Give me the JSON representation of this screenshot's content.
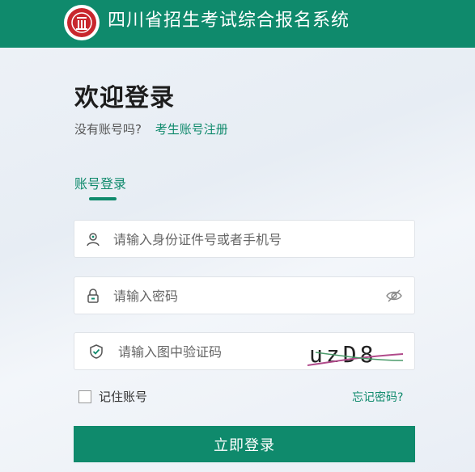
{
  "header": {
    "title": "四川省招生考试综合报名系统",
    "logo_icon": "red-seal-logo"
  },
  "login": {
    "welcome": "欢迎登录",
    "no_account": "没有账号吗?",
    "register_link": "考生账号注册",
    "tab_account": "账号登录",
    "username_placeholder": "请输入身份证件号或者手机号",
    "password_placeholder": "请输入密码",
    "captcha_placeholder": "请输入图中验证码",
    "captcha_text": "uzD8",
    "remember_label": "记住账号",
    "forgot_link": "忘记密码?",
    "submit_label": "立即登录"
  },
  "colors": {
    "brand": "#0f8a6c",
    "seal": "#c8272d"
  }
}
